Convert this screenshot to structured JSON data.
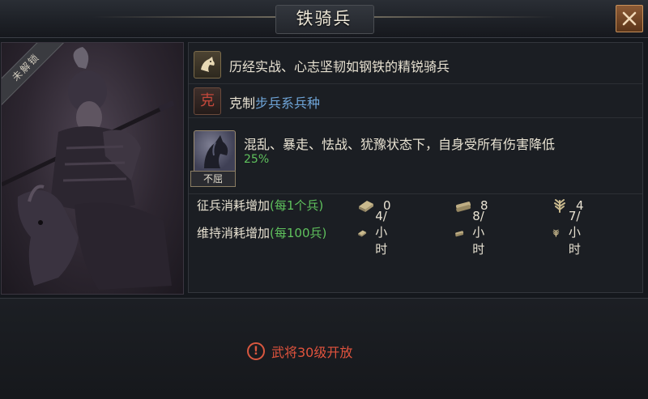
{
  "window": {
    "title": "铁骑兵",
    "close_icon": "close-icon"
  },
  "portrait": {
    "lock_ribbon": "未解锁"
  },
  "unit": {
    "description": "历经实战、心志坚韧如钢铁的精锐骑兵",
    "counter": {
      "icon_glyph": "克",
      "lead": "克制",
      "target": "步兵系兵种"
    },
    "skill": {
      "name_tag": "不屈",
      "text": "混乱、暴走、怯战、犹豫状态下，自身受所有伤害降低",
      "value": "25%"
    }
  },
  "costs": {
    "recruit": {
      "label": "征兵消耗增加",
      "unit": "(每1个兵)",
      "food": "0",
      "wood": "8",
      "grain": "4"
    },
    "upkeep": {
      "label": "维持消耗增加",
      "unit": "(每100兵)",
      "food": "4/小时",
      "wood": "8/小时",
      "grain": "7/小时"
    }
  },
  "unlock": {
    "warning_icon": "!",
    "text": "武将30级开放"
  },
  "colors": {
    "accent_green": "#5fc15d",
    "accent_blue": "#6fa5d8",
    "warning_red": "#e0533d",
    "close_orange": "#8b5a35"
  }
}
